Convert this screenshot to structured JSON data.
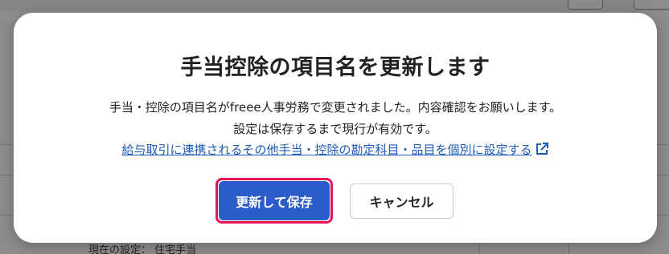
{
  "background": {
    "page_title": "",
    "current_setting": "現在の設定： 住宅手当"
  },
  "dialog": {
    "title": "手当控除の項目名を更新します",
    "message_line1": "手当・控除の項目名がfreee人事労務で変更されました。内容確認をお願いします。",
    "message_line2": "設定は保存するまで現行が有効です。",
    "link_text": "給与取引に連携されるその他手当・控除の勘定科目・品目を個別に設定する",
    "save_button": "更新して保存",
    "cancel_button": "キャンセル"
  },
  "icons": {
    "external_link": "external-link-icon"
  },
  "colors": {
    "primary": "#2b5cc9",
    "highlight_border": "#e8145a",
    "link": "#1d5bb8"
  }
}
